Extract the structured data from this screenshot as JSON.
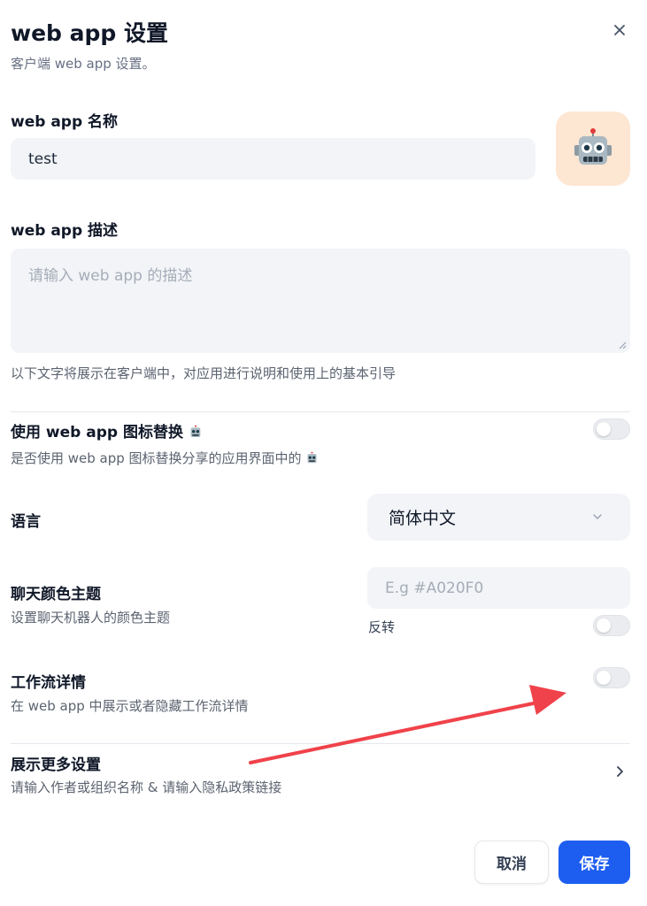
{
  "header": {
    "title": "web app 设置",
    "subtitle": "客户端 web app 设置。"
  },
  "name_field": {
    "label": "web app 名称",
    "value": "test",
    "avatar_icon": "robot-face-icon"
  },
  "description_field": {
    "label": "web app 描述",
    "placeholder": "请输入 web app 的描述",
    "hint": "以下文字将展示在客户端中，对应用进行说明和使用上的基本引导"
  },
  "use_icon_replace": {
    "label": "使用 web app 图标替换",
    "hint": "是否使用 web app 图标替换分享的应用界面中的",
    "enabled": false
  },
  "language": {
    "label": "语言",
    "selected": "简体中文"
  },
  "chat_color_theme": {
    "label": "聊天颜色主题",
    "hint": "设置聊天机器人的颜色主题",
    "placeholder": "E.g #A020F0",
    "invert_label": "反转",
    "invert_enabled": false
  },
  "workflow_details": {
    "label": "工作流详情",
    "hint": "在 web app 中展示或者隐藏工作流详情",
    "enabled": false
  },
  "more_settings": {
    "label": "展示更多设置",
    "hint": "请输入作者或组织名称 & 请输入隐私政策链接"
  },
  "footer": {
    "cancel_label": "取消",
    "save_label": "保存"
  },
  "colors": {
    "primary": "#1d5ef0",
    "annotation_arrow": "#f0424a",
    "avatar_bg": "#fde6d2"
  }
}
